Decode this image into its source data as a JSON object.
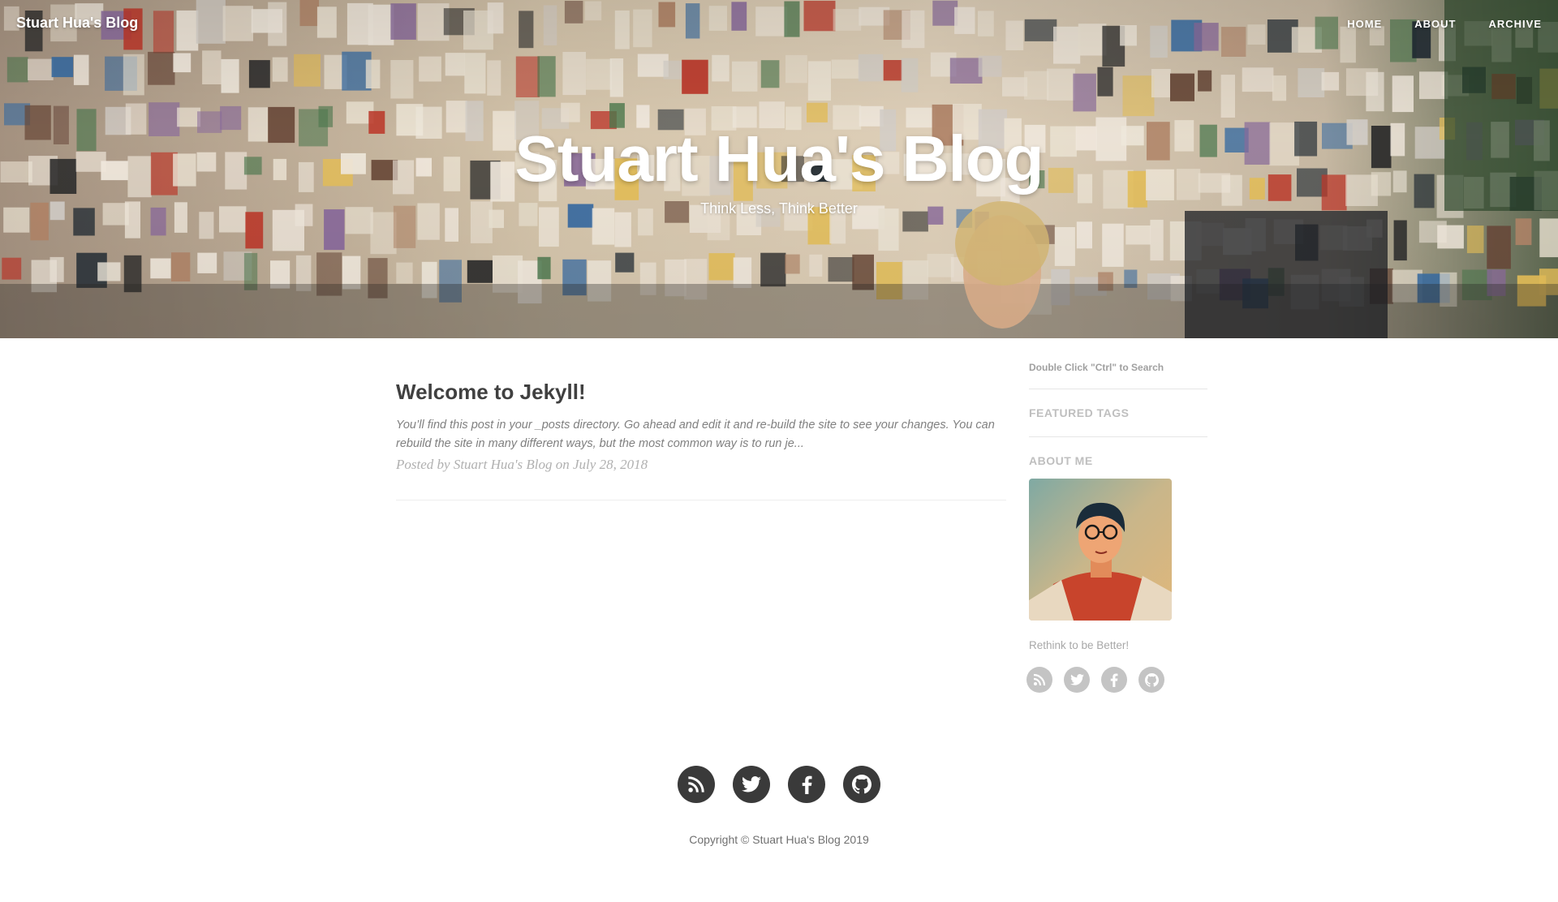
{
  "colors": {
    "hero_base": "#cdbba2",
    "text_dark": "#404040",
    "text_muted": "#808080",
    "footer_icon_bg": "#3a3a3a",
    "sidebar_icon_bg": "#c4c4c4"
  },
  "navbar": {
    "brand": "Stuart Hua's Blog",
    "links": [
      {
        "label": "HOME"
      },
      {
        "label": "ABOUT"
      },
      {
        "label": "ARCHIVE"
      }
    ]
  },
  "hero": {
    "title": "Stuart Hua's Blog",
    "subtitle": "Think Less, Think Better"
  },
  "posts": [
    {
      "title": "Welcome to Jekyll!",
      "excerpt": "You’ll find this post in your _posts directory. Go ahead and edit it and re-build the site to see your changes. You can rebuild the site in many different ways, but the most common way is to run je...",
      "meta": "Posted by Stuart Hua's Blog on July 28, 2018"
    }
  ],
  "sidebar": {
    "search_hint": "Double Click \"Ctrl\" to Search",
    "featured_tags_heading": "FEATURED TAGS",
    "about_heading": "ABOUT ME",
    "about_text": "Rethink to be Better!",
    "social_icons": [
      "rss-icon",
      "twitter-icon",
      "facebook-icon",
      "github-icon"
    ]
  },
  "footer": {
    "social_icons": [
      "rss-icon",
      "twitter-icon",
      "facebook-icon",
      "github-icon"
    ],
    "copyright": "Copyright © Stuart Hua's Blog 2019"
  }
}
